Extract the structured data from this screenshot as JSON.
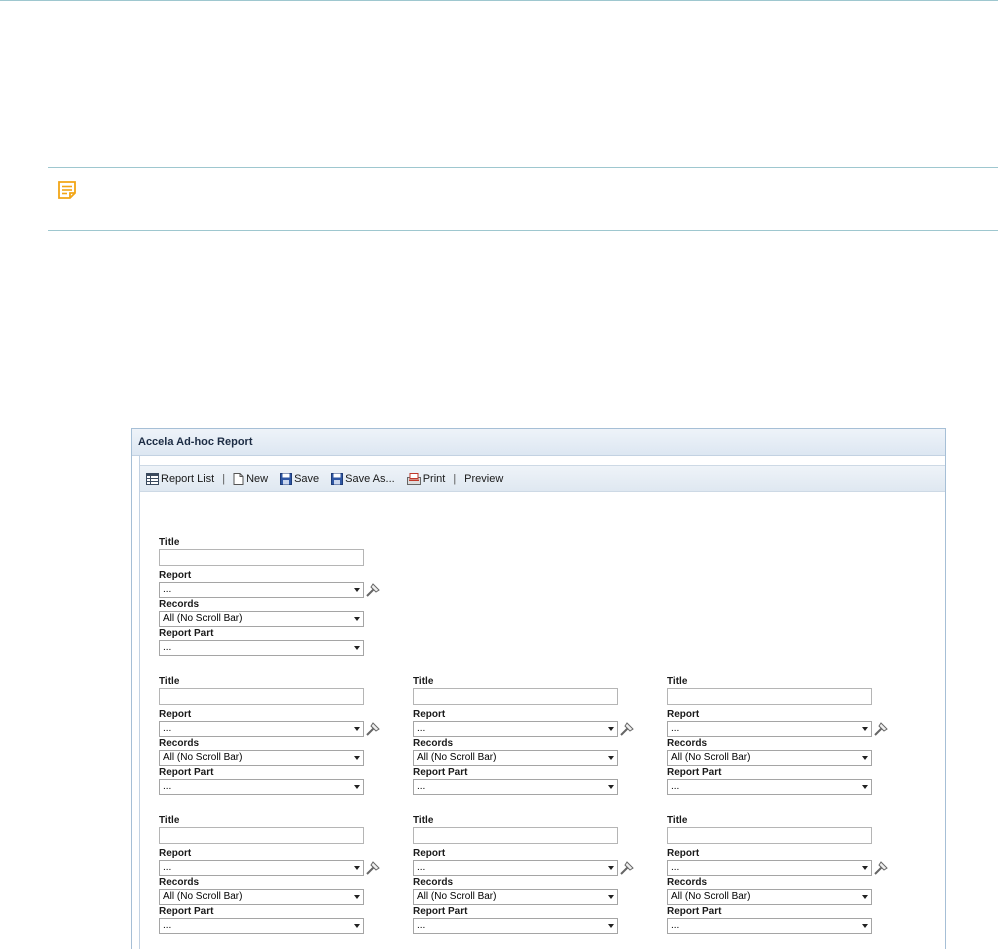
{
  "window": {
    "title": "Accela Ad-hoc Report"
  },
  "toolbar": {
    "report_list": "Report List",
    "sep1": "|",
    "new": "New",
    "save": "Save",
    "save_as": "Save As...",
    "print": "Print",
    "sep2": "|",
    "preview": "Preview"
  },
  "fields": {
    "title_label": "Title",
    "report_label": "Report",
    "records_label": "Records",
    "report_part_label": "Report Part",
    "report_value": "...",
    "records_value": "All (No Scroll Bar)",
    "report_part_value": "..."
  },
  "icons": {
    "note": "note-icon",
    "report_list": "table-icon",
    "new": "document-icon",
    "save": "floppy-disk-icon",
    "save_as": "floppy-disk-icon",
    "print": "pdf-print-icon",
    "wand": "magic-wand-icon"
  },
  "colors": {
    "rule": "#9ec7cf",
    "note_accent": "#f2a516",
    "toolbar_bg": "#e6edf5"
  }
}
